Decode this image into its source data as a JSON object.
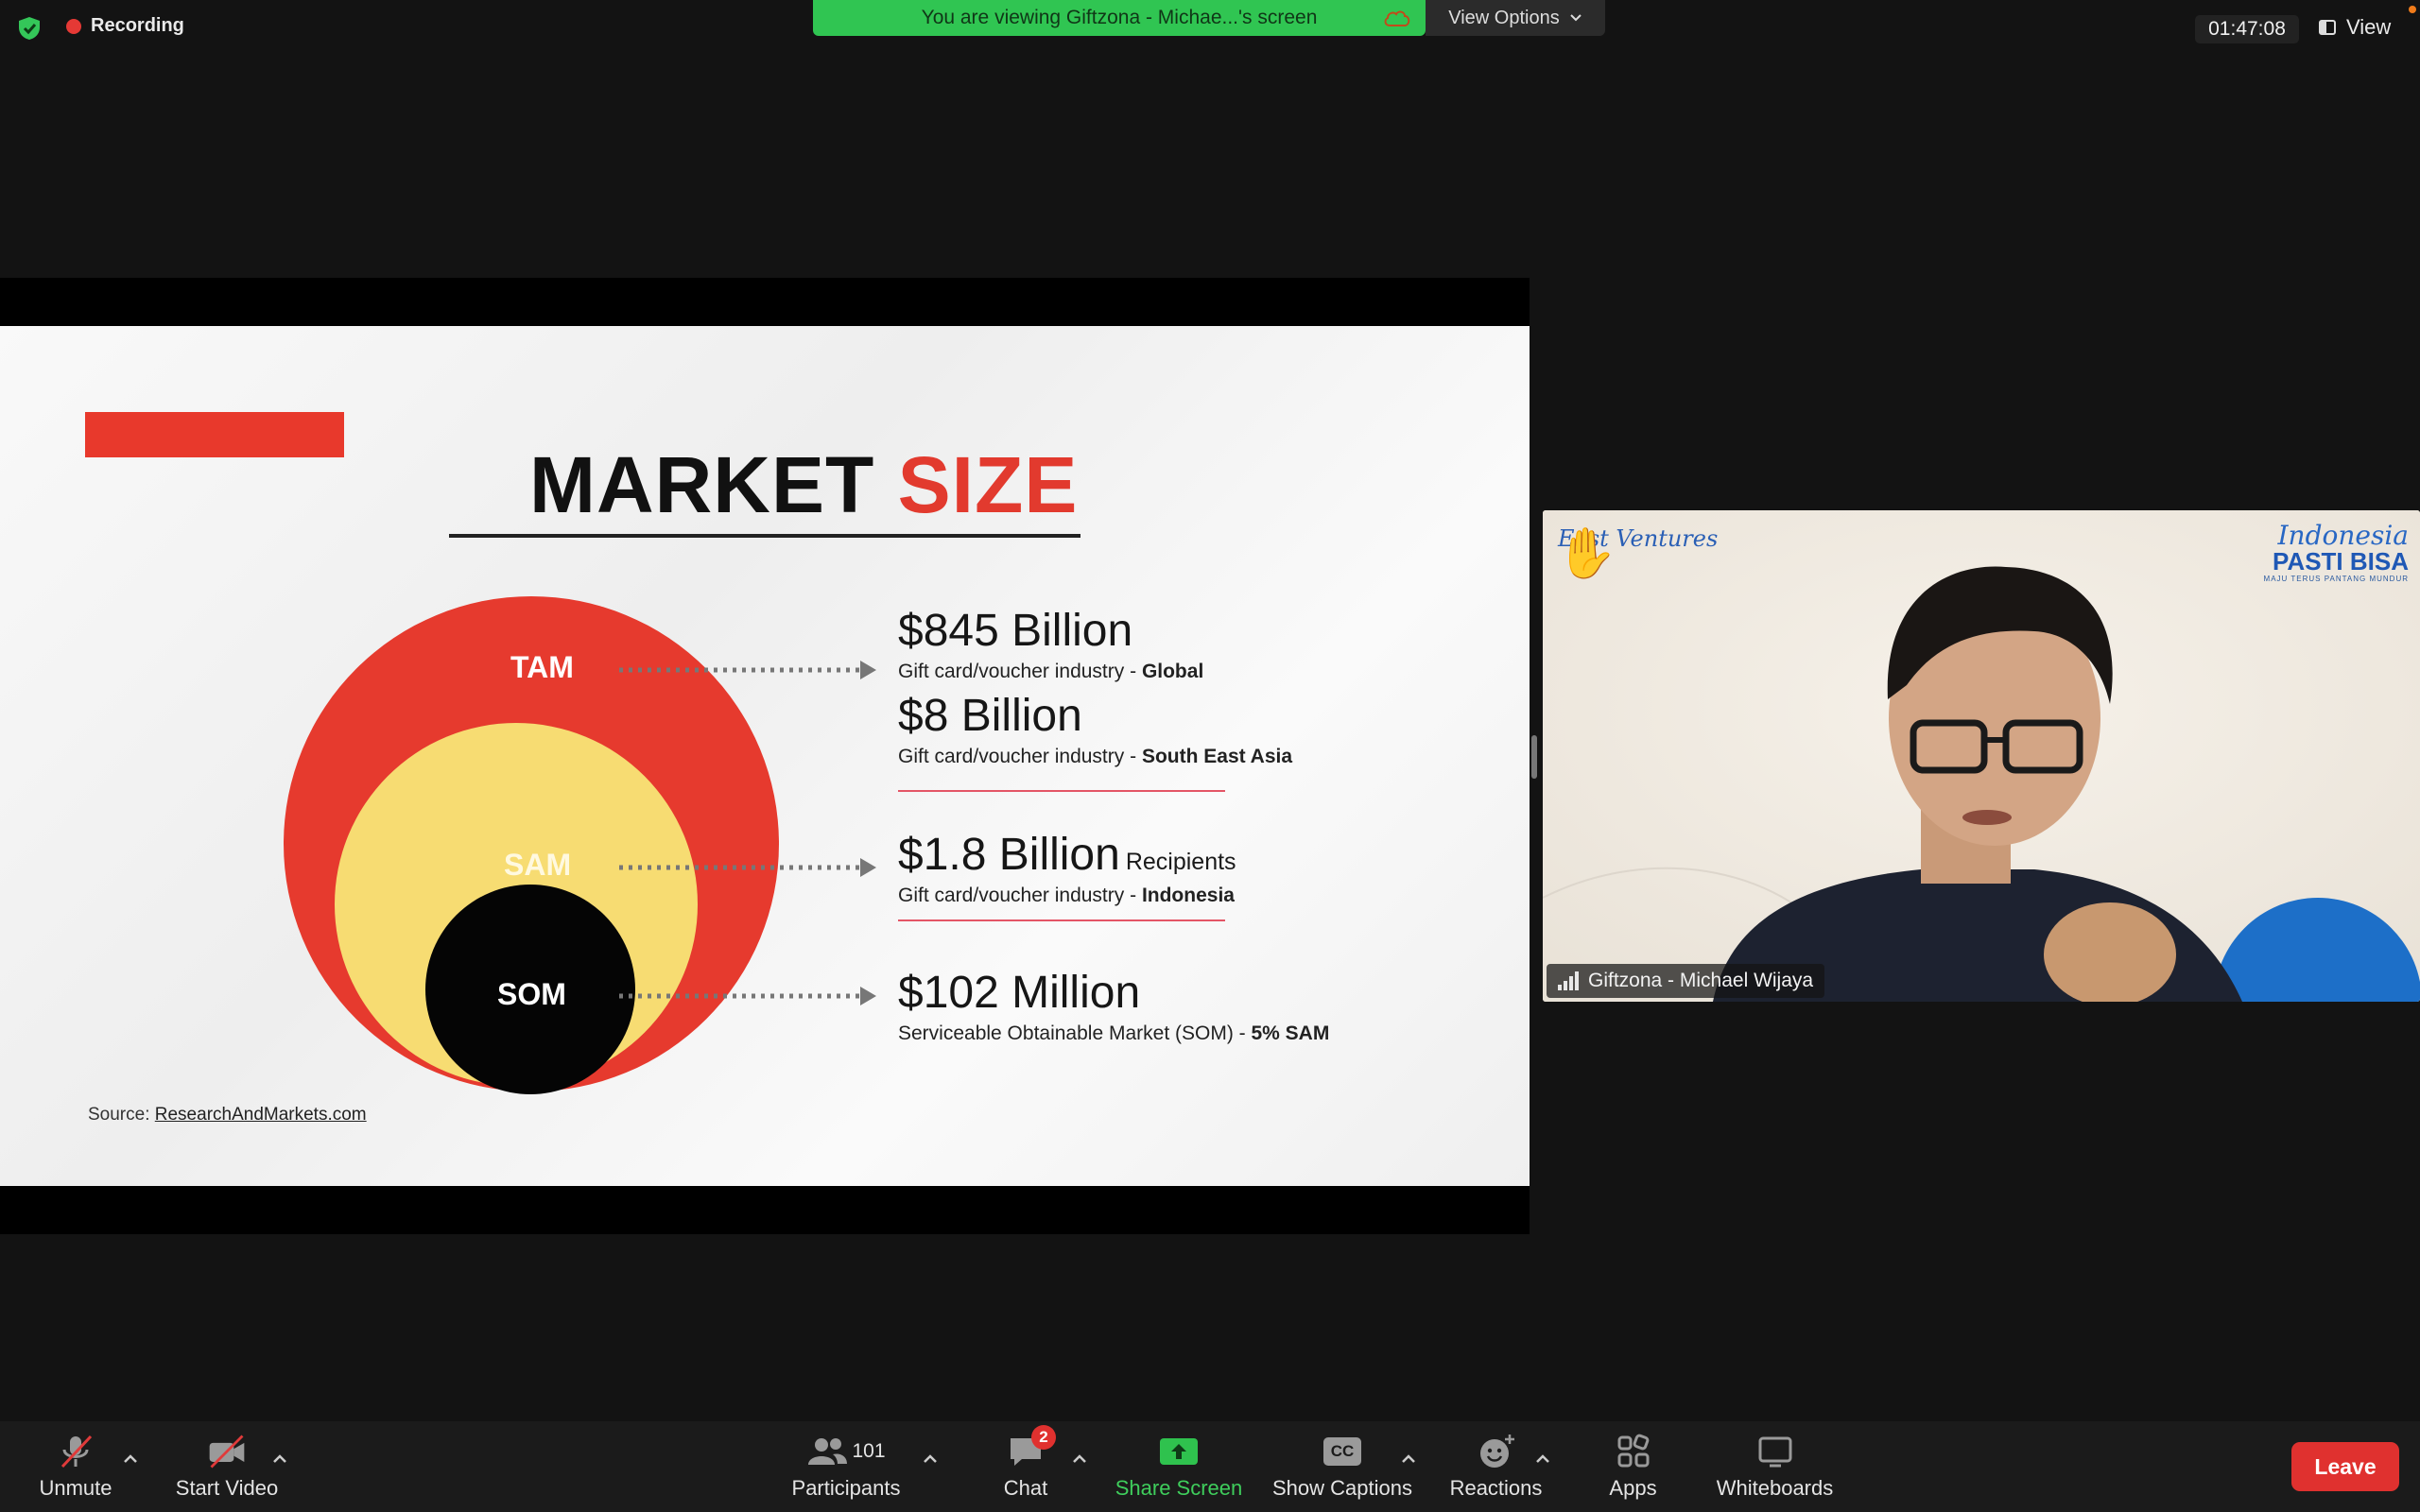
{
  "top_bar": {
    "recording_label": "Recording",
    "banner_text": "You are viewing Giftzona - Michae...'s screen",
    "view_options_label": "View Options",
    "meeting_timer": "01:47:08",
    "view_label": "View"
  },
  "slide": {
    "title_part1": "MARKET ",
    "title_part2": "SIZE",
    "circles": {
      "tam": "TAM",
      "sam": "SAM",
      "som": "SOM"
    },
    "stats": [
      {
        "value": "$845 Billion",
        "extra": "",
        "desc_prefix": "Gift card/voucher industry - ",
        "desc_bold": "Global"
      },
      {
        "value": "$8 Billion",
        "extra": "",
        "desc_prefix": "Gift card/voucher industry - ",
        "desc_bold": "South East Asia"
      },
      {
        "value": "$1.8 Billion",
        "extra": "Recipients",
        "desc_prefix": "Gift card/voucher industry - ",
        "desc_bold": "Indonesia"
      },
      {
        "value": "$102 Million",
        "extra": "",
        "desc_prefix": "Serviceable Obtainable Market (SOM) - ",
        "desc_bold": "5% SAM"
      }
    ],
    "source_prefix": "Source: ",
    "source_link": "ResearchAndMarkets.com"
  },
  "video": {
    "participant_name": "Giftzona - Michael Wijaya",
    "logo_left_text": "East Ventures",
    "logo_right_line1": "Indonesia",
    "logo_right_line2": "PASTI BISA",
    "logo_right_line3": "MAJU TERUS PANTANG MUNDUR"
  },
  "toolbar": {
    "unmute_label": "Unmute",
    "start_video_label": "Start Video",
    "participants_label": "Participants",
    "participants_count": "101",
    "chat_label": "Chat",
    "chat_badge": "2",
    "share_screen_label": "Share Screen",
    "show_captions_label": "Show Captions",
    "captions_icon_text": "CC",
    "reactions_label": "Reactions",
    "apps_label": "Apps",
    "whiteboards_label": "Whiteboards",
    "leave_label": "Leave"
  },
  "colors": {
    "banner_green": "#30c552",
    "leave_red": "#e0312f",
    "tam_red": "#e63a2e",
    "sam_yellow": "#f7dc72",
    "som_black": "#050505",
    "share_green": "#3fce5c"
  }
}
